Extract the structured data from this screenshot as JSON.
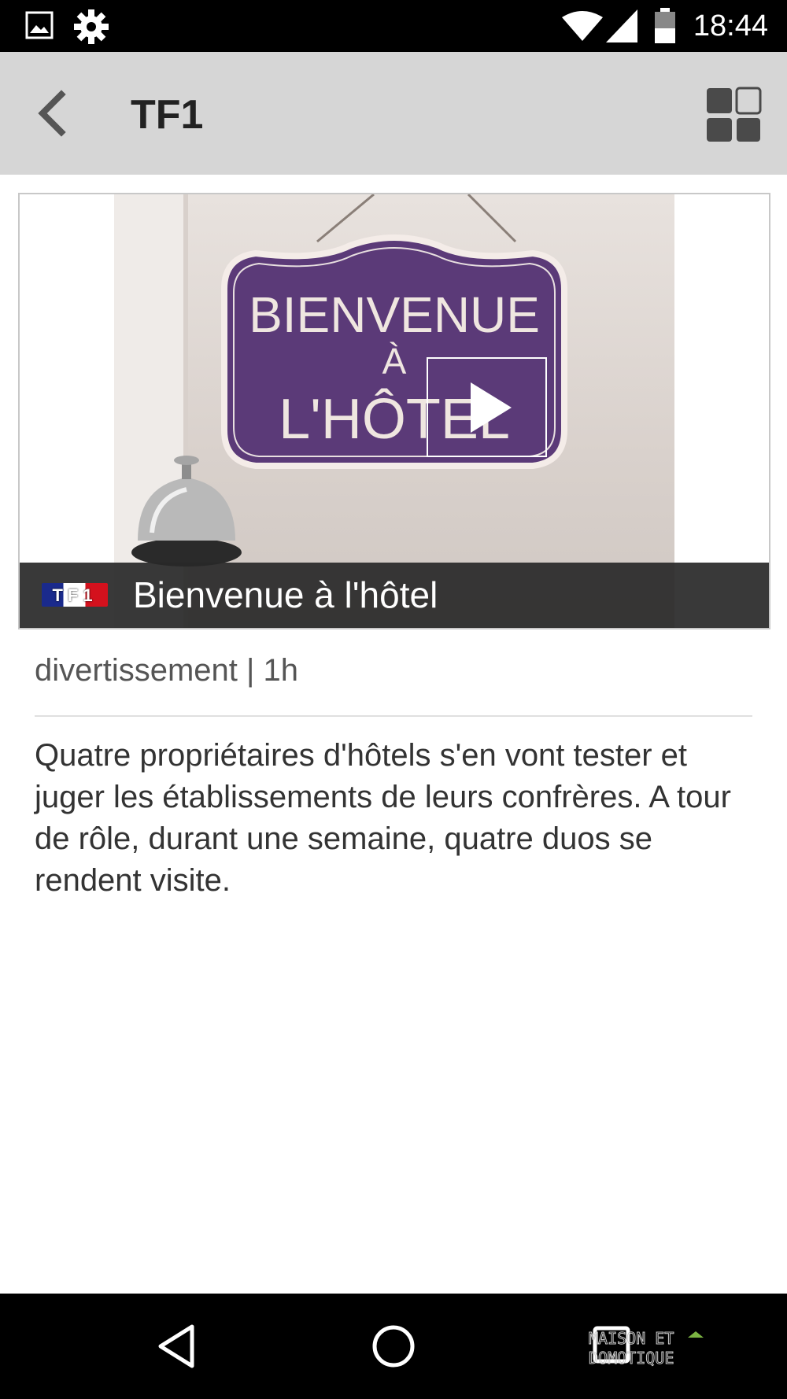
{
  "status_bar": {
    "time": "18:44",
    "icons": [
      "image-icon",
      "gear-icon",
      "wifi-icon",
      "signal-icon",
      "battery-icon"
    ]
  },
  "app_bar": {
    "title": "TF1",
    "back_icon": "chevron-left-icon",
    "layout_icon": "grid-layout-icon"
  },
  "video": {
    "channel_logo_text": "TF1",
    "title": "Bienvenue à l'hôtel",
    "play_icon": "play-icon",
    "thumbnail_sign_text": [
      "BIENVENUE",
      "À",
      "L'HÔTEL"
    ]
  },
  "details": {
    "meta": "divertissement | 1h",
    "description": "Quatre propriétaires d'hôtels s'en vont tester et juger les établissements de leurs confrères. A tour de rôle, durant une semaine, quatre duos se rendent visite."
  },
  "nav_bar": {
    "icons": [
      "back-triangle-icon",
      "home-circle-icon",
      "recents-square-icon"
    ],
    "watermark_text": "MAISON ET DOMOTIQUE"
  },
  "colors": {
    "app_bar_bg": "#d6d6d6",
    "sign_purple": "#5b3a78",
    "caption_bg": "#282828"
  }
}
